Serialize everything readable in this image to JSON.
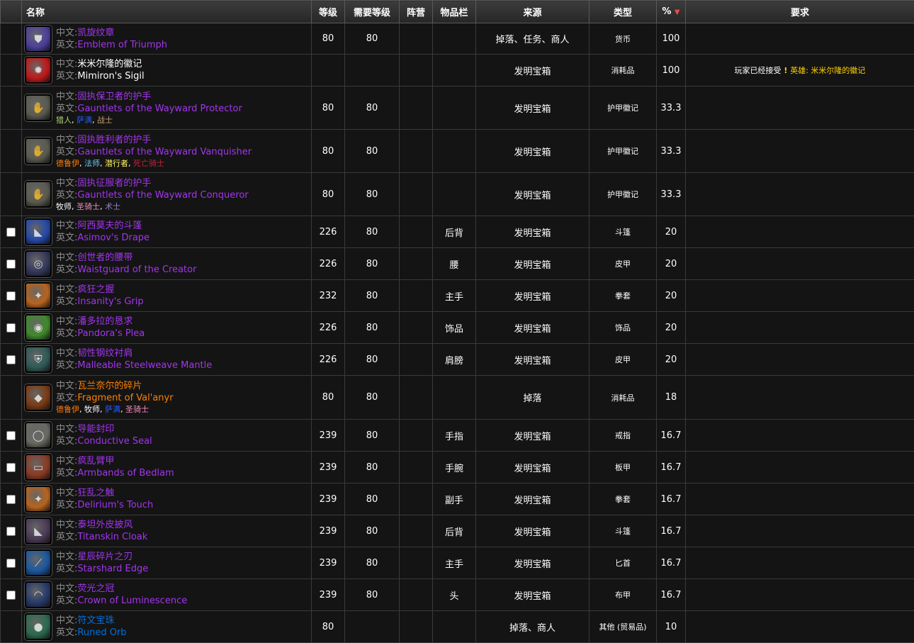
{
  "headers": {
    "name": "名称",
    "level": "等级",
    "req_level": "需要等级",
    "faction": "阵营",
    "slot": "物品栏",
    "source": "来源",
    "type": "类型",
    "percent": "%",
    "requirement": "要求"
  },
  "labels": {
    "cn": "中文:",
    "en": "英文:"
  },
  "colors": {
    "epic": "#a335ee",
    "legendary": "#ff8000",
    "rare": "#0070dd",
    "header_bg": "#2e2e2e",
    "row_bg": "#141414",
    "grid": "#3a3a3a",
    "quest": "#ffd100"
  },
  "rows": [
    {
      "checkbox": false,
      "icon": "emblem-icon",
      "icon_bg": "#4c3f9c",
      "quality": "epic",
      "cn": "凯旋纹章",
      "en": "Emblem of Triumph",
      "classes": [],
      "level": "80",
      "req_level": "80",
      "faction": "",
      "slot": "",
      "source": "掉落、任务、商人",
      "type": "货币",
      "percent": "100",
      "requirement": null
    },
    {
      "checkbox": false,
      "icon": "gear-sigil-icon",
      "icon_bg": "#c01818",
      "quality": "white",
      "cn": "米米尔隆的徽记",
      "en": "Mimiron's Sigil",
      "classes": [],
      "level": "",
      "req_level": "",
      "faction": "",
      "slot": "",
      "source": "发明宝箱",
      "type": "消耗品",
      "percent": "100",
      "requirement": {
        "prefix": "玩家已经接受",
        "icon": "quest-exclamation-icon",
        "quest": "英雄: 米米尔隆的徽记"
      }
    },
    {
      "checkbox": false,
      "icon": "gauntlets-icon",
      "icon_bg": "#5a5a50",
      "quality": "epic",
      "cn": "固执保卫者的护手",
      "en": "Gauntlets of the Wayward Protector",
      "classes": [
        {
          "name": "猎人",
          "cls": "hunter"
        },
        {
          "name": "萨满",
          "cls": "shaman"
        },
        {
          "name": "战士",
          "cls": "warrior"
        }
      ],
      "level": "80",
      "req_level": "80",
      "faction": "",
      "slot": "",
      "source": "发明宝箱",
      "type": "护甲徽记",
      "percent": "33.3",
      "requirement": null
    },
    {
      "checkbox": false,
      "icon": "gauntlets-icon",
      "icon_bg": "#5a5a50",
      "quality": "epic",
      "cn": "固执胜利者的护手",
      "en": "Gauntlets of the Wayward Vanquisher",
      "classes": [
        {
          "name": "德鲁伊",
          "cls": "druid"
        },
        {
          "name": "法师",
          "cls": "mage"
        },
        {
          "name": "潜行者",
          "cls": "rogue"
        },
        {
          "name": "死亡骑士",
          "cls": "dk"
        }
      ],
      "level": "80",
      "req_level": "80",
      "faction": "",
      "slot": "",
      "source": "发明宝箱",
      "type": "护甲徽记",
      "percent": "33.3",
      "requirement": null
    },
    {
      "checkbox": false,
      "icon": "gauntlets-icon",
      "icon_bg": "#5a5a50",
      "quality": "epic",
      "cn": "固执征服者的护手",
      "en": "Gauntlets of the Wayward Conqueror",
      "classes": [
        {
          "name": "牧师",
          "cls": "priest"
        },
        {
          "name": "圣骑士",
          "cls": "paladin"
        },
        {
          "name": "术士",
          "cls": "warlock"
        }
      ],
      "level": "80",
      "req_level": "80",
      "faction": "",
      "slot": "",
      "source": "发明宝箱",
      "type": "护甲徽记",
      "percent": "33.3",
      "requirement": null
    },
    {
      "checkbox": true,
      "icon": "cloak-icon",
      "icon_bg": "#2448a8",
      "quality": "epic",
      "cn": "阿西莫夫的斗篷",
      "en": "Asimov's Drape",
      "classes": [],
      "level": "226",
      "req_level": "80",
      "faction": "",
      "slot": "后背",
      "source": "发明宝箱",
      "type": "斗篷",
      "percent": "20",
      "requirement": null
    },
    {
      "checkbox": true,
      "icon": "belt-icon",
      "icon_bg": "#34385a",
      "quality": "epic",
      "cn": "创世者的腰带",
      "en": "Waistguard of the Creator",
      "classes": [],
      "level": "226",
      "req_level": "80",
      "faction": "",
      "slot": "腰",
      "source": "发明宝箱",
      "type": "皮甲",
      "percent": "20",
      "requirement": null
    },
    {
      "checkbox": true,
      "icon": "fist-weapon-icon",
      "icon_bg": "#b8641c",
      "quality": "epic",
      "cn": "疯狂之握",
      "en": "Insanity's Grip",
      "classes": [],
      "level": "232",
      "req_level": "80",
      "faction": "",
      "slot": "主手",
      "source": "发明宝箱",
      "type": "拳套",
      "percent": "20",
      "requirement": null
    },
    {
      "checkbox": true,
      "icon": "trinket-icon",
      "icon_bg": "#3e8a2a",
      "quality": "epic",
      "cn": "潘多拉的恳求",
      "en": "Pandora's Plea",
      "classes": [],
      "level": "226",
      "req_level": "80",
      "faction": "",
      "slot": "饰品",
      "source": "发明宝箱",
      "type": "饰品",
      "percent": "20",
      "requirement": null
    },
    {
      "checkbox": true,
      "icon": "shoulder-icon",
      "icon_bg": "#2e5a56",
      "quality": "epic",
      "cn": "韧性钢纹衬肩",
      "en": "Malleable Steelweave Mantle",
      "classes": [],
      "level": "226",
      "req_level": "80",
      "faction": "",
      "slot": "肩膀",
      "source": "发明宝箱",
      "type": "皮甲",
      "percent": "20",
      "requirement": null
    },
    {
      "checkbox": false,
      "icon": "shard-icon",
      "icon_bg": "#7a3a14",
      "quality": "leg",
      "cn": "瓦兰奈尔的碎片",
      "en": "Fragment of Val'anyr",
      "classes": [
        {
          "name": "德鲁伊",
          "cls": "druid"
        },
        {
          "name": "牧师",
          "cls": "priest"
        },
        {
          "name": "萨满",
          "cls": "shaman"
        },
        {
          "name": "圣骑士",
          "cls": "paladin"
        }
      ],
      "level": "80",
      "req_level": "80",
      "faction": "",
      "slot": "",
      "source": "掉落",
      "type": "消耗品",
      "percent": "18",
      "requirement": null
    },
    {
      "checkbox": true,
      "icon": "ring-icon",
      "icon_bg": "#6a6a62",
      "quality": "epic",
      "cn": "导能封印",
      "en": "Conductive Seal",
      "classes": [],
      "level": "239",
      "req_level": "80",
      "faction": "",
      "slot": "手指",
      "source": "发明宝箱",
      "type": "戒指",
      "percent": "16.7",
      "requirement": null
    },
    {
      "checkbox": true,
      "icon": "bracer-icon",
      "icon_bg": "#8a3a22",
      "quality": "epic",
      "cn": "疯乱臂甲",
      "en": "Armbands of Bedlam",
      "classes": [],
      "level": "239",
      "req_level": "80",
      "faction": "",
      "slot": "手腕",
      "source": "发明宝箱",
      "type": "板甲",
      "percent": "16.7",
      "requirement": null
    },
    {
      "checkbox": true,
      "icon": "fist-weapon-icon",
      "icon_bg": "#b8641c",
      "quality": "epic",
      "cn": "狂乱之触",
      "en": "Delirium's Touch",
      "classes": [],
      "level": "239",
      "req_level": "80",
      "faction": "",
      "slot": "副手",
      "source": "发明宝箱",
      "type": "拳套",
      "percent": "16.7",
      "requirement": null
    },
    {
      "checkbox": true,
      "icon": "cloak-icon",
      "icon_bg": "#4a3a56",
      "quality": "epic",
      "cn": "泰坦外皮披风",
      "en": "Titanskin Cloak",
      "classes": [],
      "level": "239",
      "req_level": "80",
      "faction": "",
      "slot": "后背",
      "source": "发明宝箱",
      "type": "斗篷",
      "percent": "16.7",
      "requirement": null
    },
    {
      "checkbox": true,
      "icon": "dagger-icon",
      "icon_bg": "#1a58a0",
      "quality": "epic",
      "cn": "星辰碎片之刃",
      "en": "Starshard Edge",
      "classes": [],
      "level": "239",
      "req_level": "80",
      "faction": "",
      "slot": "主手",
      "source": "发明宝箱",
      "type": "匕首",
      "percent": "16.7",
      "requirement": null
    },
    {
      "checkbox": true,
      "icon": "hood-icon",
      "icon_bg": "#263a6a",
      "quality": "epic",
      "cn": "荧光之冠",
      "en": "Crown of Luminescence",
      "classes": [],
      "level": "239",
      "req_level": "80",
      "faction": "",
      "slot": "头",
      "source": "发明宝箱",
      "type": "布甲",
      "percent": "16.7",
      "requirement": null
    },
    {
      "checkbox": false,
      "icon": "orb-icon",
      "icon_bg": "#2a6a4e",
      "quality": "rare",
      "cn": "符文宝珠",
      "en": "Runed Orb",
      "classes": [],
      "level": "80",
      "req_level": "",
      "faction": "",
      "slot": "",
      "source": "掉落、商人",
      "type": "其他 (贸易品)",
      "percent": "10",
      "requirement": null
    }
  ]
}
